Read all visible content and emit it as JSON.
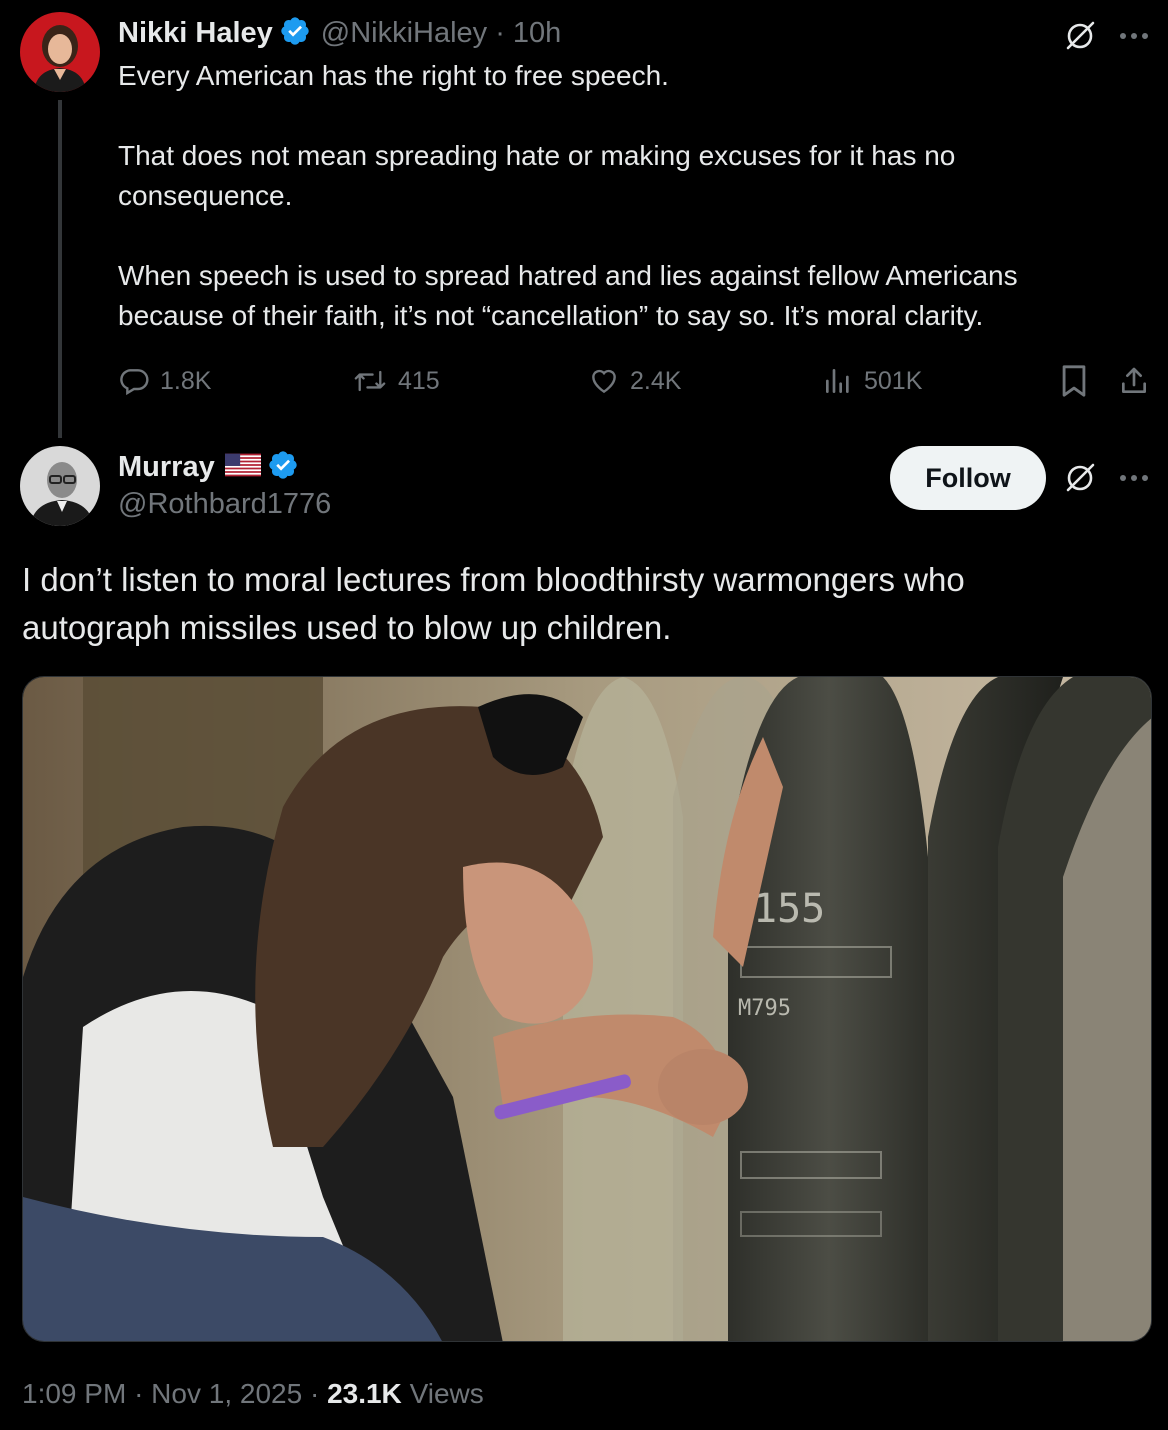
{
  "parent_tweet": {
    "author_name": "Nikki Haley",
    "handle": "@NikkiHaley",
    "separator": "·",
    "time_ago": "10h",
    "paragraphs": [
      "Every American has the right to free speech.",
      "That does not mean spreading hate or making excuses for it has no consequence.",
      "When speech is used to spread hatred and lies against fellow Americans because of their faith, it’s not “cancellation” to say so.  It’s moral clarity."
    ],
    "stats": {
      "replies": "1.8K",
      "reposts": "415",
      "likes": "2.4K",
      "views": "501K"
    }
  },
  "reply_tweet": {
    "author_name": "Murray",
    "flag": "🇺🇸",
    "handle": "@Rothbard1776",
    "follow_label": "Follow",
    "paragraphs": [
      "I don’t listen to moral lectures from bloodthirsty warmongers who autograph missiles used to blow up children."
    ],
    "shell_markings": {
      "caliber": "155",
      "code": "M795"
    },
    "timestamp": "1:09 PM",
    "date": "Nov 1, 2025",
    "views_count": "23.1K",
    "views_label": "Views"
  },
  "colors": {
    "background": "#000000",
    "text_primary": "#e7e9ea",
    "text_secondary": "#71767b",
    "verified_blue": "#1d9bf0",
    "follow_bg": "#eff3f4"
  }
}
